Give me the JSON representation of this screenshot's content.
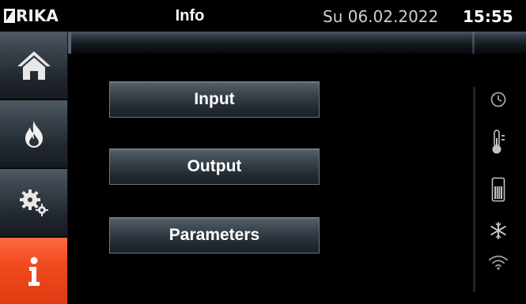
{
  "header": {
    "logo_text": "RIKA",
    "title": "Info",
    "date": "Su 06.02.2022",
    "time": "15:55"
  },
  "sidebar": {
    "items": [
      {
        "icon": "home-icon",
        "active": false
      },
      {
        "icon": "flame-icon",
        "active": false
      },
      {
        "icon": "settings-gears-icon",
        "active": false
      },
      {
        "icon": "info-icon",
        "active": true
      }
    ]
  },
  "menu": {
    "input_label": "Input",
    "output_label": "Output",
    "parameters_label": "Parameters"
  },
  "status_icons": [
    "clock-icon",
    "thermometer-icon",
    "pellet-tank-icon",
    "frost-icon",
    "wifi-icon"
  ],
  "colors": {
    "active_accent": "#f04a1f",
    "background": "#000000",
    "button_border": "#6d7780"
  }
}
